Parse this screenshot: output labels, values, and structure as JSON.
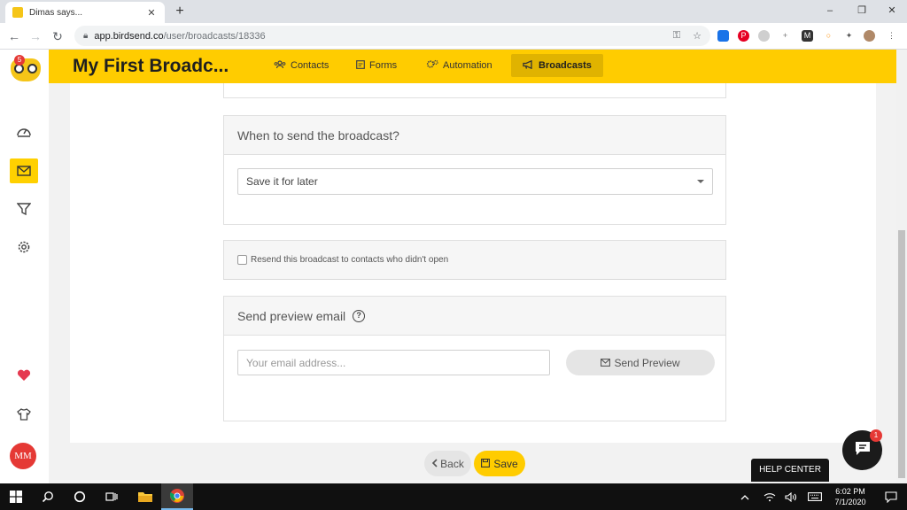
{
  "browser": {
    "tab_title": "Dimas says...",
    "tab_close": "✕",
    "new_tab": "+",
    "url_domain": "app.birdsend.co",
    "url_path": "/user/broadcasts/18336",
    "window_controls": [
      "–",
      "❐",
      "✕"
    ]
  },
  "sidebar": {
    "notification_count": "5",
    "avatar_initials": "MM"
  },
  "header": {
    "title": "My First Broadc...",
    "nav": [
      {
        "label": "Contacts",
        "icon": "users-icon"
      },
      {
        "label": "Forms",
        "icon": "form-icon"
      },
      {
        "label": "Automation",
        "icon": "gears-icon"
      },
      {
        "label": "Broadcasts",
        "icon": "megaphone-icon",
        "active": true
      }
    ]
  },
  "schedule": {
    "title": "When to send the broadcast?",
    "selected_option": "Save it for later"
  },
  "resend": {
    "label": "Resend this broadcast to contacts who didn't open",
    "checked": false
  },
  "preview": {
    "title": "Send preview email",
    "help_icon": "?",
    "email_placeholder": "Your email address...",
    "button_label": "Send Preview"
  },
  "footer": {
    "back_label": "Back",
    "save_label": "Save"
  },
  "chat": {
    "badge_count": "1",
    "help_center_label": "HELP CENTER"
  },
  "taskbar": {
    "time": "6:02 PM",
    "date": "7/1/2020"
  },
  "colors": {
    "brand_yellow": "#ffcc00",
    "active_nav": "#e0b300",
    "danger_red": "#e53935"
  }
}
